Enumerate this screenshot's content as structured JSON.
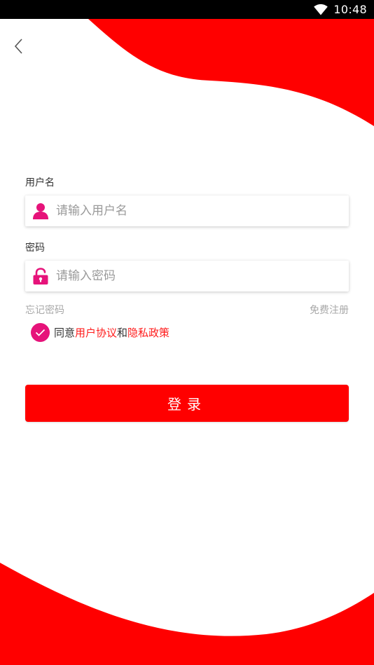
{
  "status_bar": {
    "time": "10:48",
    "wifi_icon": "wifi-icon"
  },
  "colors": {
    "primary_red": "#ff0000",
    "accent_pink": "#e6137a",
    "link_red": "#ff1b1b",
    "placeholder_gray": "#9a9a9a"
  },
  "back_icon": "chevron-left-icon",
  "username": {
    "label": "用户名",
    "placeholder": "请输入用户名",
    "value": "",
    "icon": "user-icon"
  },
  "password": {
    "label": "密码",
    "placeholder": "请输入密码",
    "value": "",
    "icon": "lock-icon"
  },
  "links": {
    "forgot_password": "忘记密码",
    "register": "免费注册"
  },
  "agreement": {
    "checked": true,
    "prefix": "同意",
    "user_agreement": "用户协议",
    "conjunction": "和",
    "privacy_policy": "隐私政策"
  },
  "login_button": {
    "label": "登录"
  }
}
